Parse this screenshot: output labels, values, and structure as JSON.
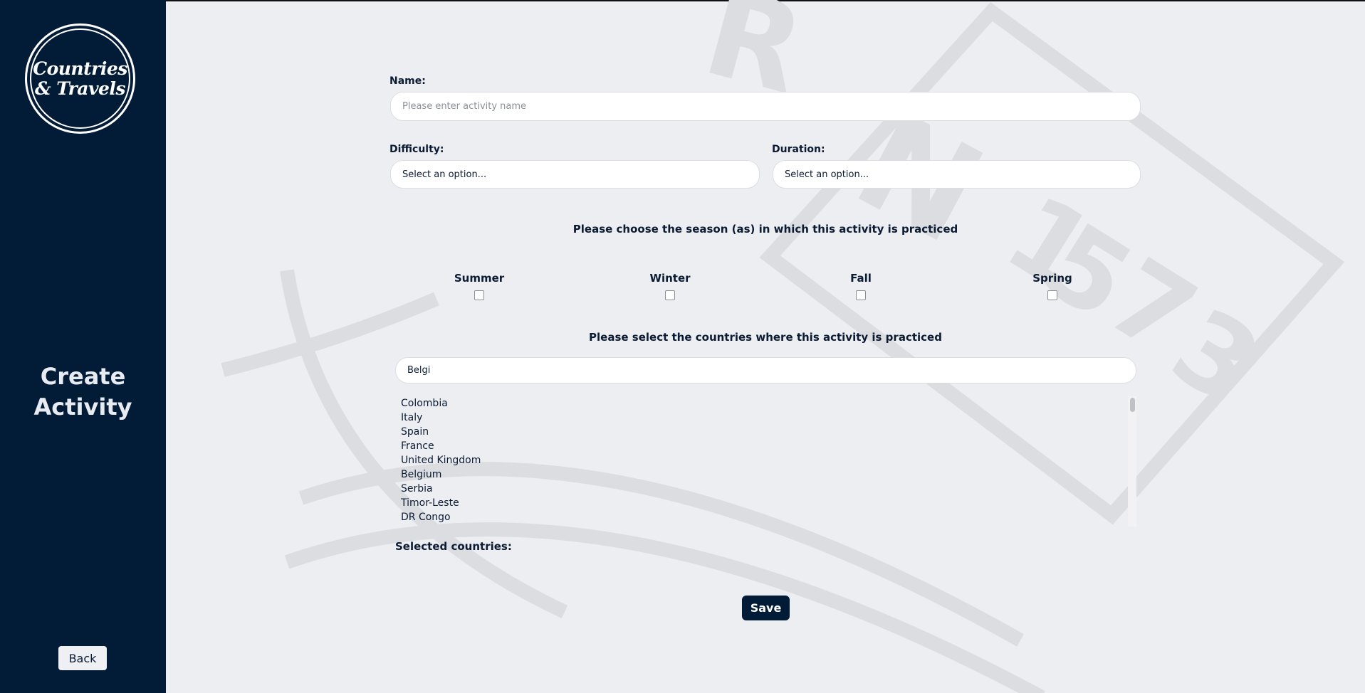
{
  "sidebar": {
    "logo_line1": "Countries",
    "logo_line2": "& Travels",
    "title_line1": "Create",
    "title_line2": "Activity",
    "back_label": "Back"
  },
  "background_art": {
    "letters": [
      "R",
      "N",
      "1",
      "5",
      "7",
      "3"
    ]
  },
  "form": {
    "name_label": "Name:",
    "name_placeholder": "Please enter activity name",
    "difficulty_label": "Difficulty:",
    "difficulty_value": "Select an option...",
    "duration_label": "Duration:",
    "duration_value": "Select an option...",
    "season_prompt": "Please choose the season (as) in which this activity is practiced",
    "seasons": [
      "Summer",
      "Winter",
      "Fall",
      "Spring"
    ],
    "countries_prompt": "Please select the countries where this activity is practiced",
    "country_search_value": "Belgi",
    "country_options": [
      "Colombia",
      "Italy",
      "Spain",
      "France",
      "United Kingdom",
      "Belgium",
      "Serbia",
      "Timor-Leste",
      "DR Congo"
    ],
    "selected_label": "Selected countries:",
    "save_label": "Save"
  },
  "colors": {
    "sidebar": "#021c38",
    "background": "#edeef1",
    "art": "#d7d8dc"
  }
}
